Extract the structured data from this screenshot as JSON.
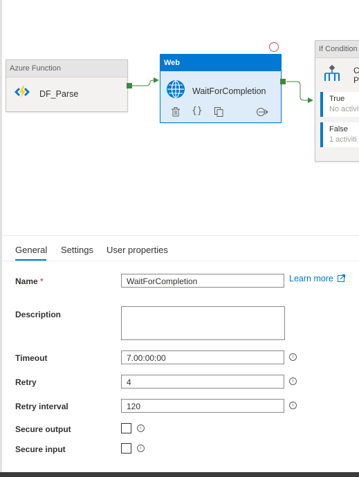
{
  "canvas": {
    "azure_function": {
      "header": "Azure Function",
      "name": "DF_Parse"
    },
    "web": {
      "header": "Web",
      "name": "WaitForCompletion"
    },
    "if_condition": {
      "header": "If Condition",
      "name_fragment": "Che Parc",
      "true_branch": {
        "label": "True",
        "status": "No activiti"
      },
      "false_branch": {
        "label": "False",
        "status": "1 activiti"
      }
    }
  },
  "tabs": [
    {
      "label": "General",
      "active": true
    },
    {
      "label": "Settings",
      "active": false
    },
    {
      "label": "User properties",
      "active": false
    }
  ],
  "form": {
    "name": {
      "label": "Name",
      "required_mark": "*",
      "value": "WaitForCompletion",
      "learn_more": "Learn more"
    },
    "description": {
      "label": "Description",
      "value": ""
    },
    "timeout": {
      "label": "Timeout",
      "value": "7.00:00:00"
    },
    "retry": {
      "label": "Retry",
      "value": "4"
    },
    "retry_interval": {
      "label": "Retry interval",
      "value": "120"
    },
    "secure_output": {
      "label": "Secure output",
      "checked": false
    },
    "secure_input": {
      "label": "Secure input",
      "checked": false
    }
  },
  "colors": {
    "accent": "#0078d4",
    "port": "#3c8a3c",
    "error": "#e04a4a"
  },
  "icons": [
    "azure-function-icon",
    "globe-icon",
    "delete-icon",
    "code-icon",
    "copy-icon",
    "add-output-icon",
    "if-condition-icon",
    "info-icon",
    "external-link-icon"
  ]
}
